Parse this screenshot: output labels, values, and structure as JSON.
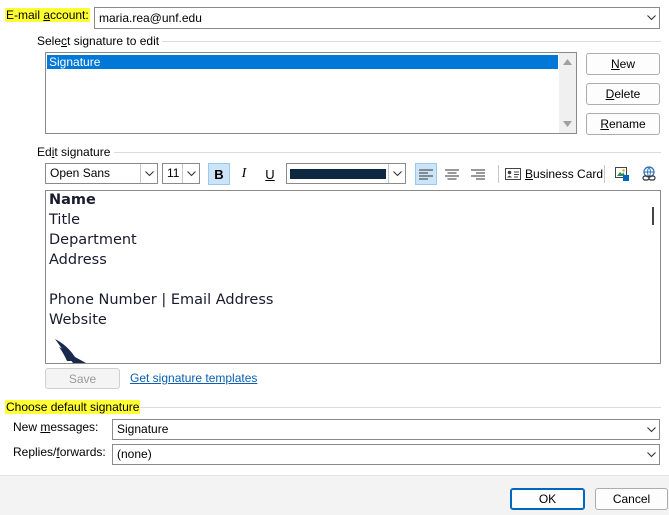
{
  "email_account": {
    "label_prefix": "E-mail ",
    "label_accel": "a",
    "label_suffix": "ccount:",
    "value": "maria.rea@unf.edu"
  },
  "select_signature": {
    "label_prefix": "Sele",
    "label_accel": "c",
    "label_suffix": "t signature to edit",
    "items": [
      "Signature"
    ]
  },
  "signature_buttons": {
    "new_accel": "N",
    "new_rest": "ew",
    "delete_accel": "D",
    "delete_rest": "elete",
    "rename_accel": "R",
    "rename_rest": "ename"
  },
  "edit_signature": {
    "label_prefix": "Ed",
    "label_accel": "i",
    "label_suffix": "t signature"
  },
  "toolbar": {
    "font": "Open Sans",
    "size": "11",
    "bold": "B",
    "italic": "I",
    "underline": "U",
    "font_color": "#0d2840",
    "business_card_accel": "B",
    "business_card_rest": "usiness Card"
  },
  "editor": {
    "name": "Name",
    "title": "Title",
    "department": "Department",
    "address": "Address",
    "contact": "Phone Number | Email Address",
    "website": "Website"
  },
  "save_label": "Save",
  "templates_link": "Get signature templates",
  "default_signature": {
    "heading": "Choose default signature",
    "new_messages_prefix": "New ",
    "new_messages_accel": "m",
    "new_messages_suffix": "essages:",
    "new_messages_value": "Signature",
    "replies_prefix": "Replies/",
    "replies_accel": "f",
    "replies_suffix": "orwards:",
    "replies_value": "(none)"
  },
  "footer": {
    "ok": "OK",
    "cancel": "Cancel"
  }
}
